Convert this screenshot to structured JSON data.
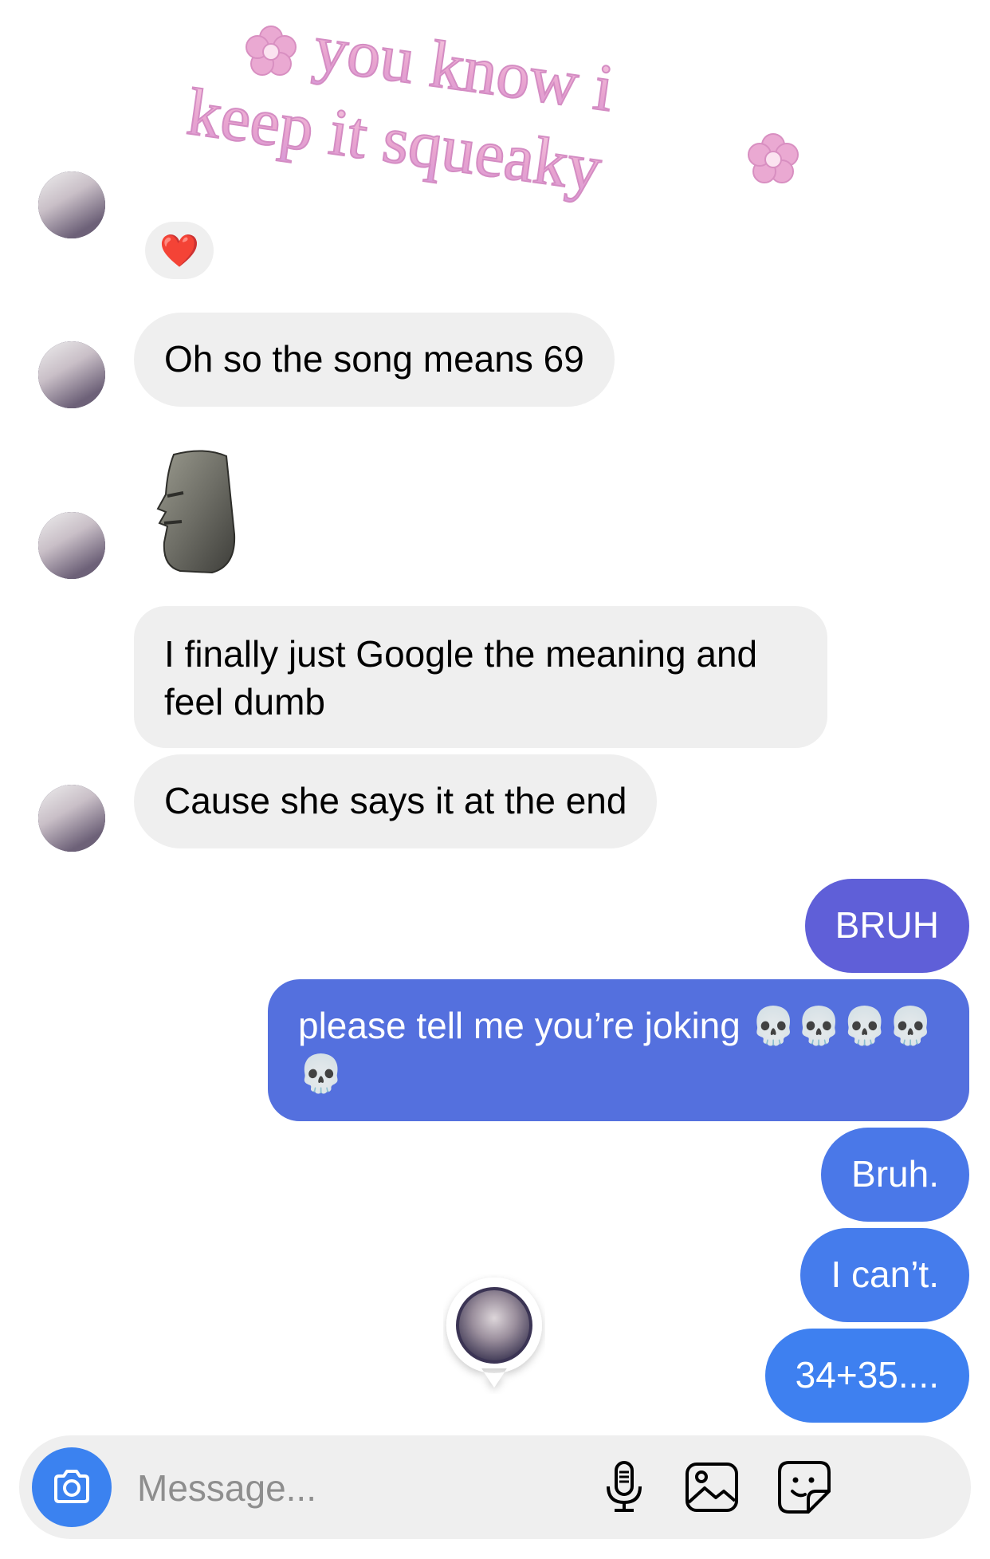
{
  "sticker": {
    "line1": "you know i",
    "line2": "keep it squeaky"
  },
  "reaction": {
    "icon": "heart-icon",
    "glyph": "❤️",
    "color": "#e0142a"
  },
  "messages": {
    "in1": "Oh so the song means 69",
    "in2": "I finally just Google the meaning and feel dumb",
    "in3": "Cause she says it at the end",
    "out1": "BRUH",
    "out2": "please tell me you’re joking 💀💀💀💀💀",
    "out3": "Bruh.",
    "out4": "I can’t.",
    "out5": "34+35...."
  },
  "colors": {
    "incoming_bg": "#efefef",
    "outgoing_grad_top": "#5b5fd8",
    "outgoing_grad_bottom": "#3e7cf0",
    "composer_bg": "#efefef",
    "camera_bg": "#3b82f0"
  },
  "composer": {
    "placeholder": "Message...",
    "icons": [
      "camera-icon",
      "microphone-icon",
      "gallery-icon",
      "sticker-icon"
    ]
  }
}
